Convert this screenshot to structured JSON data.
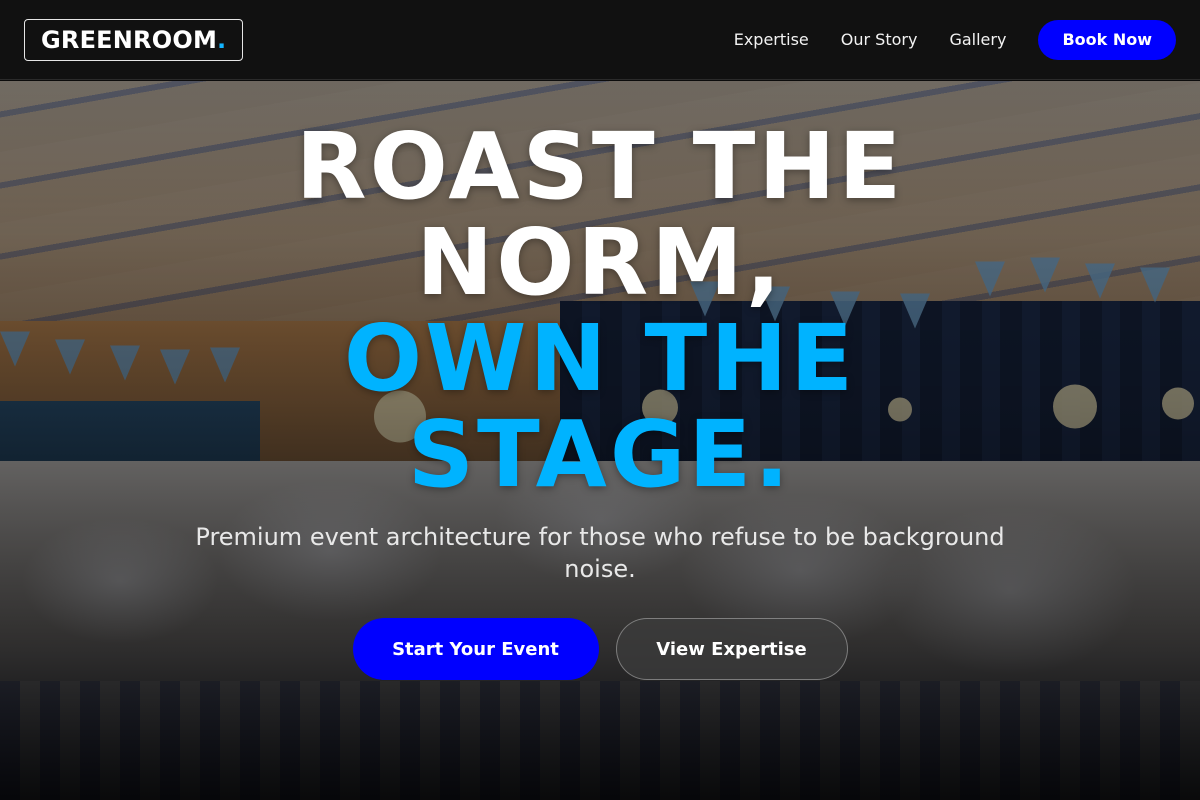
{
  "header": {
    "logo_text": "GREENROOM",
    "logo_dot": ".",
    "nav": [
      {
        "label": "Expertise"
      },
      {
        "label": "Our Story"
      },
      {
        "label": "Gallery"
      }
    ],
    "cta_label": "Book Now"
  },
  "hero": {
    "headline_white_1": "ROAST THE",
    "headline_white_2": "NORM,",
    "headline_blue_1": "OWN THE",
    "headline_blue_2": "STAGE.",
    "subhead": "Premium event architecture for those who refuse to be background noise.",
    "primary_cta": "Start Your Event",
    "secondary_cta": "View Expertise"
  },
  "colors": {
    "accent_blue": "#0000ff",
    "headline_blue": "#00b3ff",
    "header_bg": "#111111"
  }
}
